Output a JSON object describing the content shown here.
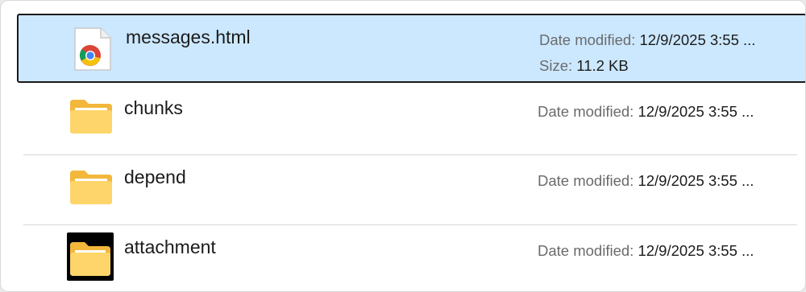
{
  "files": [
    {
      "name": "messages.html",
      "icon": "chrome-html-file-icon",
      "date_label": "Date modified:",
      "date_value": "12/9/2025 3:55 ...",
      "size_label": "Size:",
      "size_value": "11.2 KB",
      "selected": true
    },
    {
      "name": "chunks",
      "icon": "folder-icon",
      "date_label": "Date modified:",
      "date_value": "12/9/2025 3:55 ..."
    },
    {
      "name": "depend",
      "icon": "folder-icon",
      "date_label": "Date modified:",
      "date_value": "12/9/2025 3:55 ..."
    },
    {
      "name": "attachment",
      "icon": "folder-icon",
      "date_label": "Date modified:",
      "date_value": "12/9/2025 3:55 ..."
    }
  ],
  "colors": {
    "selection_bg": "#cce8ff",
    "folder_yellow": "#f8c94a",
    "folder_light": "#fde39a"
  }
}
